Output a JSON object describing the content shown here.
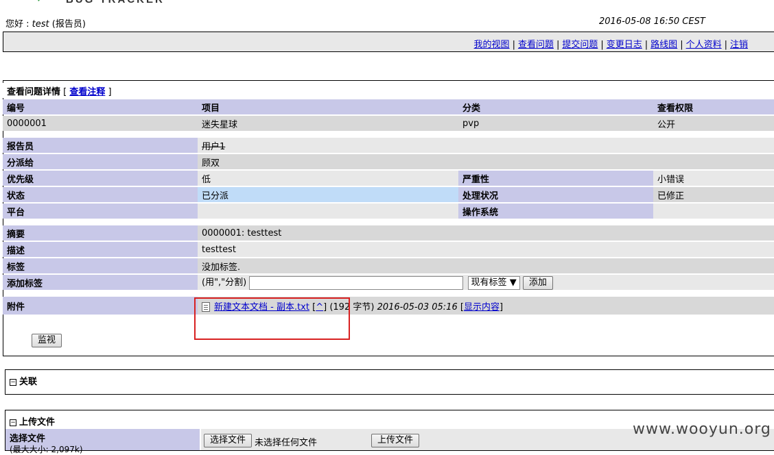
{
  "header": {
    "logo_text": "BUG TRACKER",
    "greeting_prefix": "您好 : ",
    "username": "test",
    "greeting_suffix": " (报告员)",
    "datetime": "2016-05-08 16:50 CEST"
  },
  "menu": [
    "我的视图",
    "查看问题",
    "提交问题",
    "变更日志",
    "路线图",
    "个人资料",
    "注销"
  ],
  "panel": {
    "title": "查看问题详情",
    "notes_link": "查看注释",
    "bracket_open": " [ ",
    "bracket_close": " ]"
  },
  "columns": [
    "编号",
    "项目",
    "分类",
    "查看权限"
  ],
  "summary_row": [
    "0000001",
    "迷失星球",
    "pvp",
    "公开"
  ],
  "fields": {
    "reporter_label": "报告员",
    "reporter": "用户1",
    "assigned_label": "分派给",
    "assigned": "顾双",
    "priority_label": "优先级",
    "priority": "低",
    "severity_label": "严重性",
    "severity": "小错误",
    "status_label": "状态",
    "status": "已分派",
    "resolution_label": "处理状况",
    "resolution": "已修正",
    "platform_label": "平台",
    "platform": "",
    "os_label": "操作系统",
    "os": "",
    "summary_label": "摘要",
    "summary": "0000001: testtest",
    "desc_label": "描述",
    "desc": "testtest",
    "tags_label": "标签",
    "tags": "没加标签.",
    "addtag_label": "添加标签",
    "addtag_hint": "(用\",\"分割)",
    "existing_tags": "现有标签",
    "add_button": "添加",
    "attach_label": "附件",
    "attach_file": "新建文本文档 - 副本.txt",
    "attach_caret": "^",
    "attach_size": "(192 字节)",
    "attach_date": "2016-05-03 05:16",
    "attach_show": "显示内容",
    "watch_button": "监视"
  },
  "relations": {
    "title": "关联"
  },
  "upload": {
    "title": "上传文件",
    "choose_label": "选择文件",
    "max_size": "(最大大小: 2,097k)",
    "choose_button": "选择文件",
    "no_file": "未选择任何文件",
    "upload_button": "上传文件"
  },
  "watermark": "www.wooyun.org",
  "colors": {
    "header_bg": "#c8c8e8",
    "row_light": "#e8e8e8",
    "row_dark": "#d8d8d8",
    "status_blue": "#c0dcf8",
    "highlight_red": "#d82020"
  }
}
